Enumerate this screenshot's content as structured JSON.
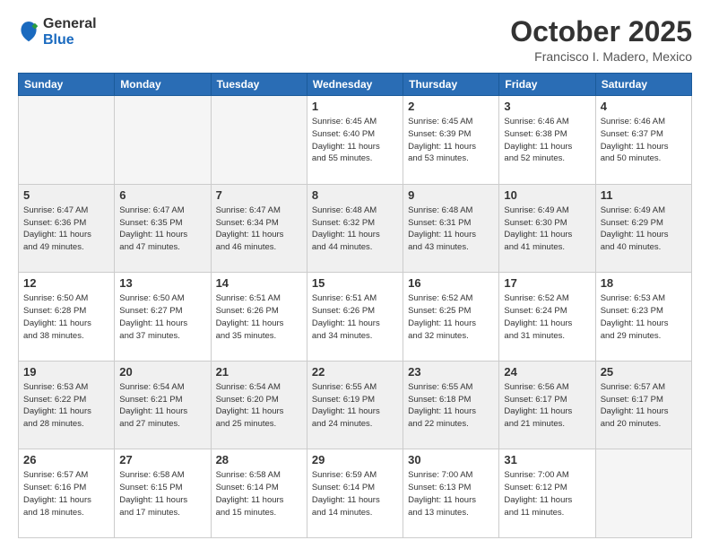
{
  "header": {
    "logo_general": "General",
    "logo_blue": "Blue",
    "month_title": "October 2025",
    "location": "Francisco I. Madero, Mexico"
  },
  "days_of_week": [
    "Sunday",
    "Monday",
    "Tuesday",
    "Wednesday",
    "Thursday",
    "Friday",
    "Saturday"
  ],
  "weeks": [
    [
      {
        "day": "",
        "info": "",
        "empty": true
      },
      {
        "day": "",
        "info": "",
        "empty": true
      },
      {
        "day": "",
        "info": "",
        "empty": true
      },
      {
        "day": "1",
        "info": "Sunrise: 6:45 AM\nSunset: 6:40 PM\nDaylight: 11 hours\nand 55 minutes."
      },
      {
        "day": "2",
        "info": "Sunrise: 6:45 AM\nSunset: 6:39 PM\nDaylight: 11 hours\nand 53 minutes."
      },
      {
        "day": "3",
        "info": "Sunrise: 6:46 AM\nSunset: 6:38 PM\nDaylight: 11 hours\nand 52 minutes."
      },
      {
        "day": "4",
        "info": "Sunrise: 6:46 AM\nSunset: 6:37 PM\nDaylight: 11 hours\nand 50 minutes."
      }
    ],
    [
      {
        "day": "5",
        "info": "Sunrise: 6:47 AM\nSunset: 6:36 PM\nDaylight: 11 hours\nand 49 minutes.",
        "shaded": true
      },
      {
        "day": "6",
        "info": "Sunrise: 6:47 AM\nSunset: 6:35 PM\nDaylight: 11 hours\nand 47 minutes.",
        "shaded": true
      },
      {
        "day": "7",
        "info": "Sunrise: 6:47 AM\nSunset: 6:34 PM\nDaylight: 11 hours\nand 46 minutes.",
        "shaded": true
      },
      {
        "day": "8",
        "info": "Sunrise: 6:48 AM\nSunset: 6:32 PM\nDaylight: 11 hours\nand 44 minutes.",
        "shaded": true
      },
      {
        "day": "9",
        "info": "Sunrise: 6:48 AM\nSunset: 6:31 PM\nDaylight: 11 hours\nand 43 minutes.",
        "shaded": true
      },
      {
        "day": "10",
        "info": "Sunrise: 6:49 AM\nSunset: 6:30 PM\nDaylight: 11 hours\nand 41 minutes.",
        "shaded": true
      },
      {
        "day": "11",
        "info": "Sunrise: 6:49 AM\nSunset: 6:29 PM\nDaylight: 11 hours\nand 40 minutes.",
        "shaded": true
      }
    ],
    [
      {
        "day": "12",
        "info": "Sunrise: 6:50 AM\nSunset: 6:28 PM\nDaylight: 11 hours\nand 38 minutes."
      },
      {
        "day": "13",
        "info": "Sunrise: 6:50 AM\nSunset: 6:27 PM\nDaylight: 11 hours\nand 37 minutes."
      },
      {
        "day": "14",
        "info": "Sunrise: 6:51 AM\nSunset: 6:26 PM\nDaylight: 11 hours\nand 35 minutes."
      },
      {
        "day": "15",
        "info": "Sunrise: 6:51 AM\nSunset: 6:26 PM\nDaylight: 11 hours\nand 34 minutes."
      },
      {
        "day": "16",
        "info": "Sunrise: 6:52 AM\nSunset: 6:25 PM\nDaylight: 11 hours\nand 32 minutes."
      },
      {
        "day": "17",
        "info": "Sunrise: 6:52 AM\nSunset: 6:24 PM\nDaylight: 11 hours\nand 31 minutes."
      },
      {
        "day": "18",
        "info": "Sunrise: 6:53 AM\nSunset: 6:23 PM\nDaylight: 11 hours\nand 29 minutes."
      }
    ],
    [
      {
        "day": "19",
        "info": "Sunrise: 6:53 AM\nSunset: 6:22 PM\nDaylight: 11 hours\nand 28 minutes.",
        "shaded": true
      },
      {
        "day": "20",
        "info": "Sunrise: 6:54 AM\nSunset: 6:21 PM\nDaylight: 11 hours\nand 27 minutes.",
        "shaded": true
      },
      {
        "day": "21",
        "info": "Sunrise: 6:54 AM\nSunset: 6:20 PM\nDaylight: 11 hours\nand 25 minutes.",
        "shaded": true
      },
      {
        "day": "22",
        "info": "Sunrise: 6:55 AM\nSunset: 6:19 PM\nDaylight: 11 hours\nand 24 minutes.",
        "shaded": true
      },
      {
        "day": "23",
        "info": "Sunrise: 6:55 AM\nSunset: 6:18 PM\nDaylight: 11 hours\nand 22 minutes.",
        "shaded": true
      },
      {
        "day": "24",
        "info": "Sunrise: 6:56 AM\nSunset: 6:17 PM\nDaylight: 11 hours\nand 21 minutes.",
        "shaded": true
      },
      {
        "day": "25",
        "info": "Sunrise: 6:57 AM\nSunset: 6:17 PM\nDaylight: 11 hours\nand 20 minutes.",
        "shaded": true
      }
    ],
    [
      {
        "day": "26",
        "info": "Sunrise: 6:57 AM\nSunset: 6:16 PM\nDaylight: 11 hours\nand 18 minutes."
      },
      {
        "day": "27",
        "info": "Sunrise: 6:58 AM\nSunset: 6:15 PM\nDaylight: 11 hours\nand 17 minutes."
      },
      {
        "day": "28",
        "info": "Sunrise: 6:58 AM\nSunset: 6:14 PM\nDaylight: 11 hours\nand 15 minutes."
      },
      {
        "day": "29",
        "info": "Sunrise: 6:59 AM\nSunset: 6:14 PM\nDaylight: 11 hours\nand 14 minutes."
      },
      {
        "day": "30",
        "info": "Sunrise: 7:00 AM\nSunset: 6:13 PM\nDaylight: 11 hours\nand 13 minutes."
      },
      {
        "day": "31",
        "info": "Sunrise: 7:00 AM\nSunset: 6:12 PM\nDaylight: 11 hours\nand 11 minutes."
      },
      {
        "day": "",
        "info": "",
        "empty": true
      }
    ]
  ]
}
